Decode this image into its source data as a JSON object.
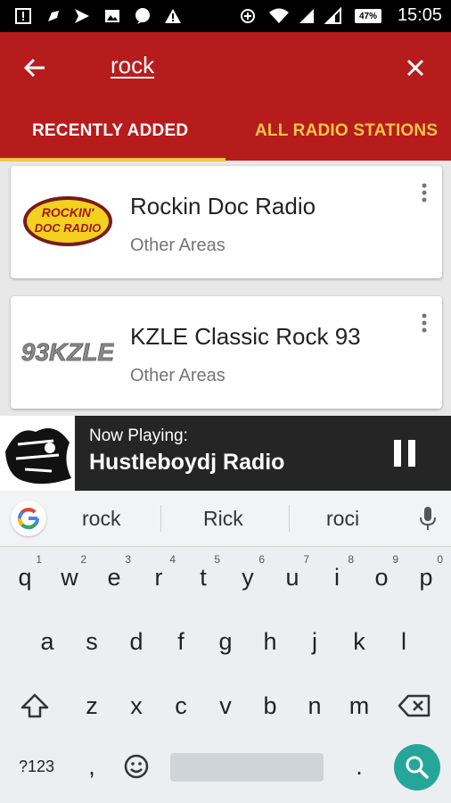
{
  "status_bar": {
    "time": "15:05",
    "battery": "47%",
    "icons": [
      "alert-icon",
      "android-icon",
      "send-icon",
      "image-icon",
      "chat-icon",
      "warning-icon",
      "data-saver-icon",
      "wifi-icon",
      "signal-icon",
      "signal-icon-2",
      "battery-icon"
    ]
  },
  "search": {
    "query": "rock"
  },
  "tabs": [
    {
      "label": "RECENTLY ADDED",
      "active": true
    },
    {
      "label": "ALL RADIO STATIONS",
      "active": false
    }
  ],
  "stations": [
    {
      "name": "Rockin Doc Radio",
      "area": "Other Areas",
      "logo_text": "ROCKIN' DOC RADIO"
    },
    {
      "name": "KZLE Classic Rock 93",
      "area": "Other Areas",
      "logo_text": "93KZLE"
    }
  ],
  "now_playing": {
    "label": "Now Playing:",
    "station": "Hustleboydj Radio"
  },
  "keyboard": {
    "suggestions": [
      "rock",
      "Rick",
      "roci"
    ],
    "row1": [
      "q",
      "w",
      "e",
      "r",
      "t",
      "y",
      "u",
      "i",
      "o",
      "p"
    ],
    "row1_hints": [
      "1",
      "2",
      "3",
      "4",
      "5",
      "6",
      "7",
      "8",
      "9",
      "0"
    ],
    "row2": [
      "a",
      "s",
      "d",
      "f",
      "g",
      "h",
      "j",
      "k",
      "l"
    ],
    "row3": [
      "z",
      "x",
      "c",
      "v",
      "b",
      "n",
      "m"
    ],
    "symbols_key": "?123",
    "comma": ",",
    "period": "."
  },
  "colors": {
    "appbar": "#b71c1c",
    "accent": "#f7c44a",
    "player": "#252525",
    "search_key": "#26a69a"
  }
}
